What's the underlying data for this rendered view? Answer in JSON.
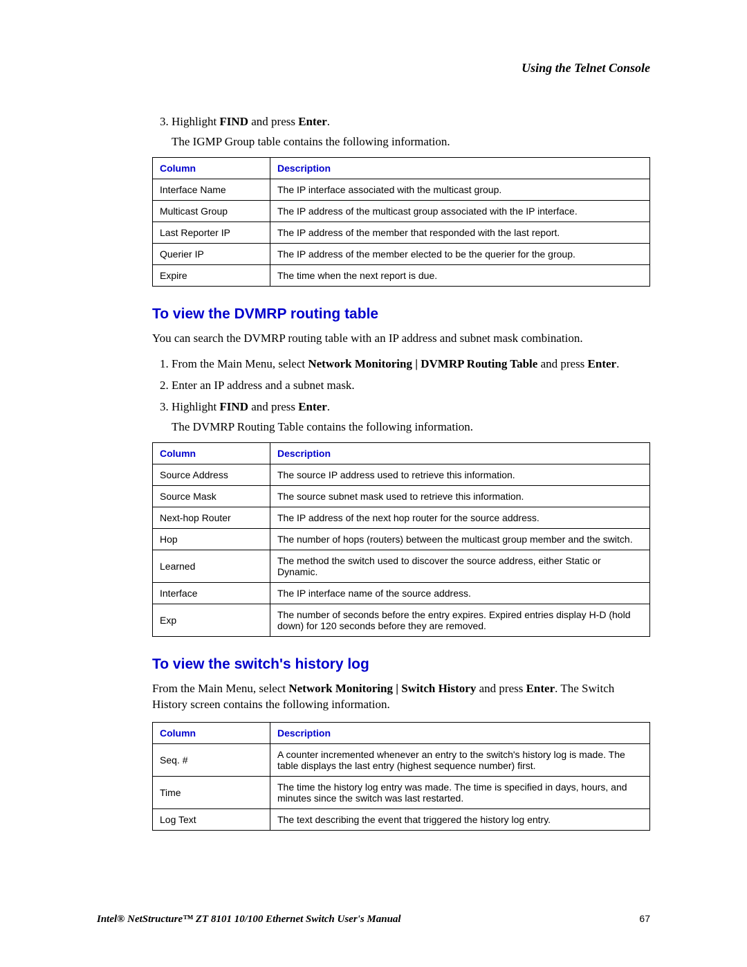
{
  "header": {
    "running_head": "Using the Telnet Console"
  },
  "intro_steps": {
    "start": 3,
    "items": [
      {
        "pre": "Highlight ",
        "bold1": "FIND",
        "mid": " and press ",
        "bold2": "Enter",
        "post": ".",
        "follow": "The IGMP Group table contains the following information."
      }
    ]
  },
  "table1": {
    "col_label": "Column",
    "desc_label": "Description",
    "rows": [
      {
        "c": "Interface Name",
        "d": "The IP interface associated with the multicast group."
      },
      {
        "c": "Multicast Group",
        "d": "The IP address of the multicast group associated with the IP interface."
      },
      {
        "c": "Last Reporter IP",
        "d": "The IP address of the member that responded with the last report."
      },
      {
        "c": "Querier IP",
        "d": "The IP address of the member elected to be the querier for the group."
      },
      {
        "c": "Expire",
        "d": "The time when the next report is due."
      }
    ]
  },
  "section_dvmrp": {
    "heading": "To view the DVMRP routing table",
    "intro": "You can search the DVMRP routing table with an IP address and subnet mask combination.",
    "steps": [
      {
        "pre": "From the Main Menu, select ",
        "bold1": "Network Monitoring | DVMRP Routing Table",
        "mid": " and press ",
        "bold2": "Enter",
        "post": "."
      },
      {
        "plain": "Enter an IP address and a subnet mask."
      },
      {
        "pre": "Highlight ",
        "bold1": "FIND",
        "mid": " and press ",
        "bold2": "Enter",
        "post": ".",
        "follow": "The DVMRP Routing Table contains the following information."
      }
    ]
  },
  "table2": {
    "col_label": "Column",
    "desc_label": "Description",
    "rows": [
      {
        "c": "Source Address",
        "d": "The source IP address used to retrieve this information."
      },
      {
        "c": "Source Mask",
        "d": "The source subnet mask used to retrieve this information."
      },
      {
        "c": "Next-hop Router",
        "d": "The IP address of the next hop router for the source address."
      },
      {
        "c": "Hop",
        "d": "The number of hops (routers) between the multicast group member and the switch."
      },
      {
        "c": "Learned",
        "d": "The method the switch used to discover the source address, either Static or Dynamic."
      },
      {
        "c": "Interface",
        "d": "The IP interface name of the source address."
      },
      {
        "c": "Exp",
        "d": "The number of seconds before the entry expires. Expired entries display H-D (hold down) for 120 seconds before they are removed."
      }
    ]
  },
  "section_history": {
    "heading": "To view the switch's history log",
    "intro_pre": "From the Main Menu, select ",
    "intro_bold1": "Network Monitoring | Switch History",
    "intro_mid": " and press ",
    "intro_bold2": "Enter",
    "intro_post": ". The Switch History screen contains the following information."
  },
  "table3": {
    "col_label": "Column",
    "desc_label": "Description",
    "rows": [
      {
        "c": "Seq. #",
        "d": "A counter incremented whenever an entry to the switch's history log is made. The table displays the last entry (highest sequence number) first."
      },
      {
        "c": "Time",
        "d": "The time the history log entry was made. The time is specified in days, hours, and minutes since the switch was last restarted."
      },
      {
        "c": "Log Text",
        "d": "The text describing the event that triggered the history log entry."
      }
    ]
  },
  "footer": {
    "manual": "Intel® NetStructure™  ZT 8101 10/100 Ethernet Switch User's Manual",
    "page": "67"
  }
}
